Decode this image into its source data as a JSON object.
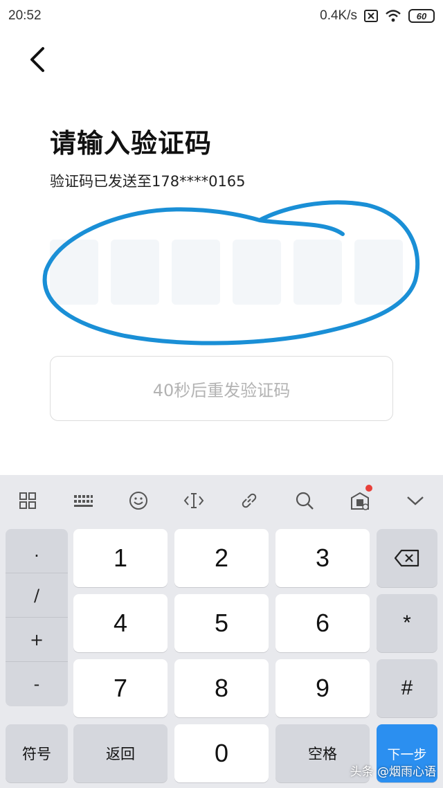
{
  "status_bar": {
    "time": "20:52",
    "net_speed": "0.4K/s",
    "battery": "60",
    "icons": [
      "sim-off-icon",
      "wifi-icon",
      "battery-icon"
    ]
  },
  "header": {
    "back_icon": "chevron-left-icon"
  },
  "main": {
    "title": "请输入验证码",
    "subtitle": "验证码已发送至178****0165",
    "code_box_count": 6,
    "resend_label": "40秒后重发验证码",
    "annotation_color": "#1a8fd6"
  },
  "keyboard": {
    "toolbar_icons": [
      "grid-icon",
      "keyboard-icon",
      "emoji-icon",
      "cursor-icon",
      "link-icon",
      "search-icon",
      "app-icon",
      "chevron-down-icon"
    ],
    "symbol_keys": [
      ".",
      "/",
      "+",
      "-"
    ],
    "digits": [
      "1",
      "2",
      "3",
      "4",
      "5",
      "6",
      "7",
      "8",
      "9",
      "0"
    ],
    "star_key": "*",
    "hash_key": "#",
    "symbols_label": "符号",
    "back_label": "返回",
    "space_label": "空格",
    "next_label": "下一步",
    "accent": "#2b8ff0"
  },
  "watermark": "头条 @烟雨心语"
}
